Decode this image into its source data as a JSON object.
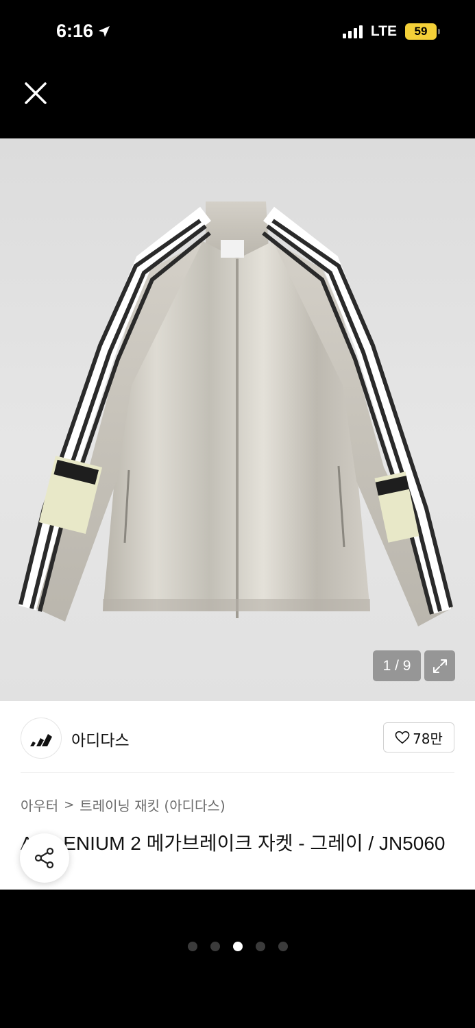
{
  "status_bar": {
    "time": "6:16",
    "network": "LTE",
    "battery": "59"
  },
  "gallery": {
    "counter": "1 / 9"
  },
  "brand": {
    "name": "아디다스",
    "likes": "78만"
  },
  "breadcrumb": {
    "category": "아우터",
    "separator": ">",
    "subcategory": "트레이닝 재킷 (아디다스)"
  },
  "product": {
    "title": "ADILENIUM 2 메가브레이크 자켓 - 그레이 / JN5060"
  },
  "pager": {
    "count": 5,
    "active_index": 2
  },
  "colors": {
    "background": "#000000",
    "accent_battery": "#f4d038",
    "text_primary": "#111111",
    "text_secondary": "#6b6b6b"
  },
  "icons": {
    "close": "close-icon",
    "share": "share-icon",
    "like": "heart-icon",
    "expand": "expand-icon",
    "brand_logo": "adidas-logo"
  }
}
